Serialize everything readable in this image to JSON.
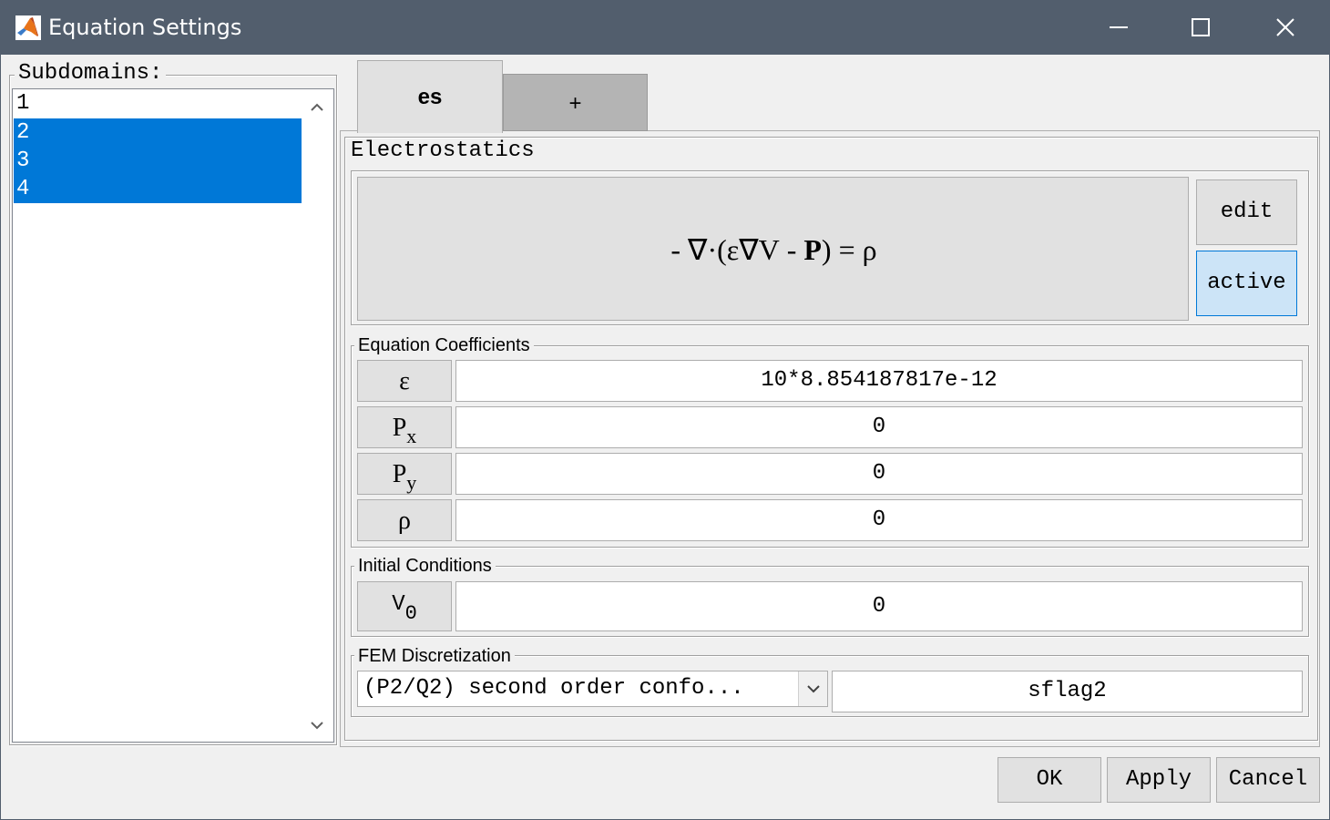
{
  "window": {
    "title": "Equation Settings"
  },
  "subdomains": {
    "label": "Subdomains:",
    "items": [
      {
        "label": "1",
        "selected": false
      },
      {
        "label": "2",
        "selected": true
      },
      {
        "label": "3",
        "selected": true
      },
      {
        "label": "4",
        "selected": true
      }
    ]
  },
  "tabs": [
    {
      "label": "es",
      "active": true
    },
    {
      "label": "+",
      "active": false
    }
  ],
  "physics": {
    "group_label": "Electrostatics",
    "equation": "- ∇·(ε∇V - P) = ρ",
    "edit_label": "edit",
    "active_label": "active"
  },
  "coefficients": {
    "group_label": "Equation Coefficients",
    "rows": [
      {
        "symbol": "ε",
        "subscript": "",
        "value": "10*8.854187817e-12"
      },
      {
        "symbol": "P",
        "subscript": "x",
        "value": "0"
      },
      {
        "symbol": "P",
        "subscript": "y",
        "value": "0"
      },
      {
        "symbol": "ρ",
        "subscript": "",
        "value": "0"
      }
    ]
  },
  "initial_conditions": {
    "group_label": "Initial Conditions",
    "rows": [
      {
        "symbol": "V",
        "subscript": "0",
        "value": "0"
      }
    ]
  },
  "fem": {
    "group_label": "FEM Discretization",
    "selected_option": "(P2/Q2) second order confo...",
    "shape_function": "sflag2"
  },
  "footer": {
    "ok_label": "OK",
    "apply_label": "Apply",
    "cancel_label": "Cancel"
  },
  "colors": {
    "titlebar": "#525e6d",
    "selection": "#0078d7",
    "active_button": "#cce4f7"
  }
}
